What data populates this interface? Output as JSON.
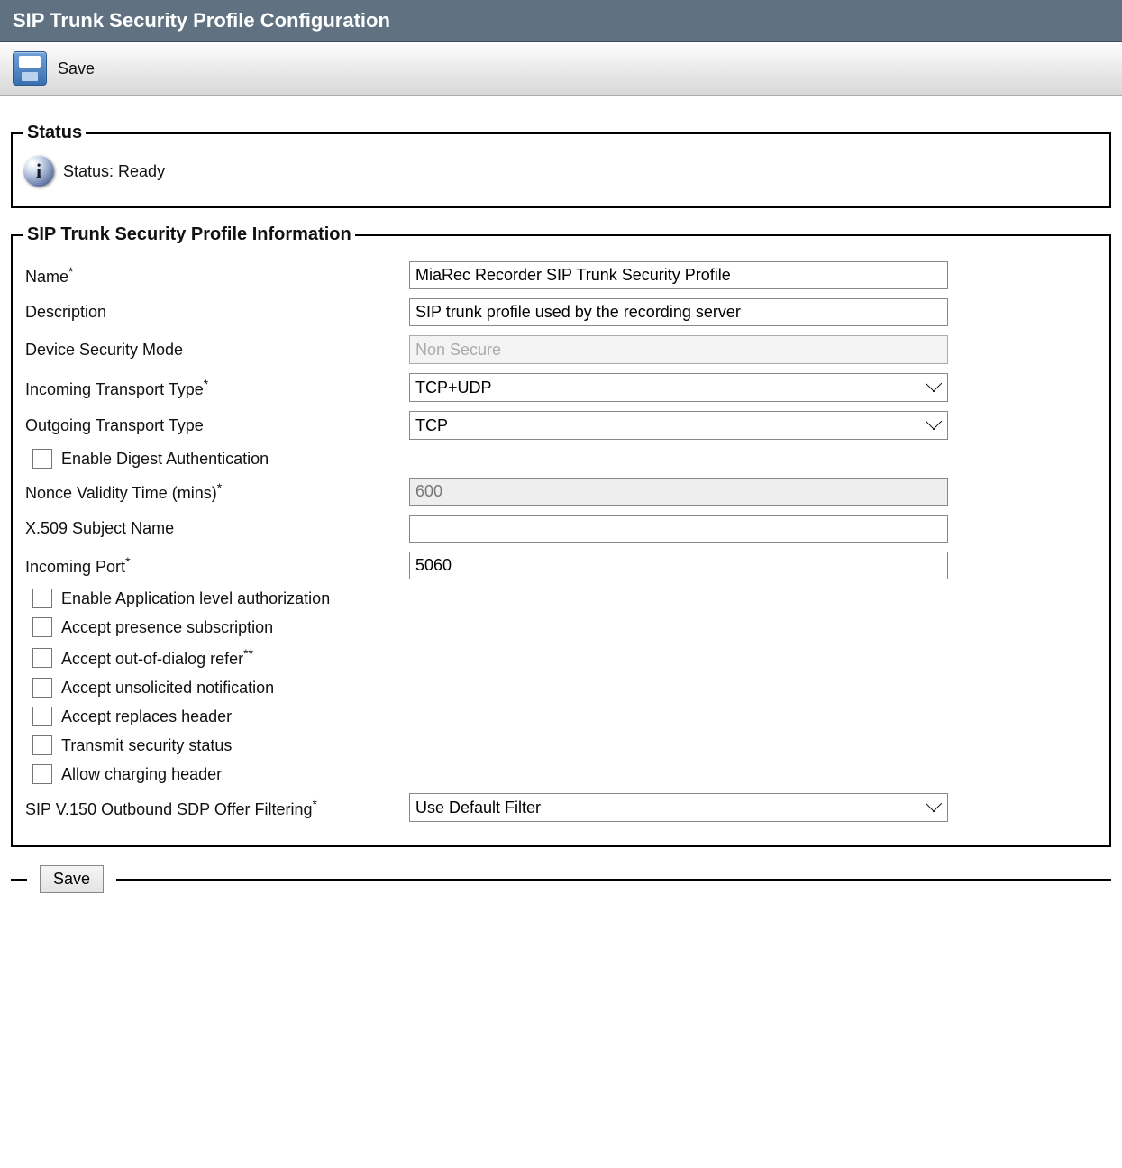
{
  "header": {
    "title": "SIP Trunk Security Profile Configuration"
  },
  "toolbar": {
    "save_label": "Save"
  },
  "status": {
    "legend": "Status",
    "text": "Status: Ready"
  },
  "profile": {
    "legend": "SIP Trunk Security Profile Information",
    "labels": {
      "name": "Name",
      "description": "Description",
      "device_security_mode": "Device Security Mode",
      "incoming_transport_type": "Incoming Transport Type",
      "outgoing_transport_type": "Outgoing Transport Type",
      "enable_digest_auth": "Enable Digest Authentication",
      "nonce_validity": "Nonce Validity Time (mins)",
      "x509_subject": "X.509 Subject Name",
      "incoming_port": "Incoming Port",
      "enable_app_auth": "Enable Application level authorization",
      "accept_presence": "Accept presence subscription",
      "accept_refer": "Accept out-of-dialog refer",
      "accept_unsolicited": "Accept unsolicited notification",
      "accept_replaces": "Accept replaces header",
      "transmit_security": "Transmit security status",
      "allow_charging": "Allow charging header",
      "sdp_filtering": "SIP V.150 Outbound SDP Offer Filtering"
    },
    "required": {
      "single": "*",
      "double": "**"
    },
    "values": {
      "name": "MiaRec Recorder SIP Trunk Security Profile",
      "description": "SIP trunk profile used by the recording server",
      "device_security_mode": "Non Secure",
      "incoming_transport_type": "TCP+UDP",
      "outgoing_transport_type": "TCP",
      "nonce_validity": "600",
      "x509_subject": "",
      "incoming_port": "5060",
      "sdp_filtering": "Use Default Filter"
    },
    "checkboxes": {
      "enable_digest_auth": false,
      "enable_app_auth": false,
      "accept_presence": false,
      "accept_refer": false,
      "accept_unsolicited": false,
      "accept_replaces": false,
      "transmit_security": false,
      "allow_charging": false
    }
  },
  "footer": {
    "save_label": "Save"
  }
}
